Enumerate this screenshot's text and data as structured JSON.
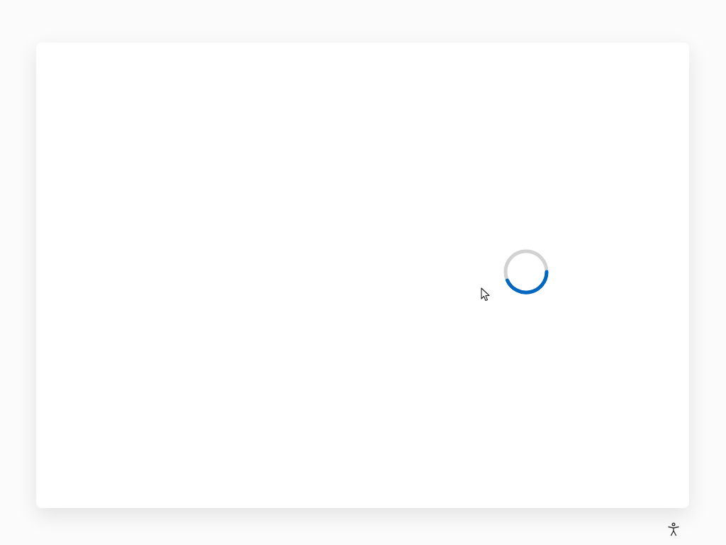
{
  "dialog": {
    "loading": true
  },
  "accessibility_button": {
    "shown": true
  }
}
